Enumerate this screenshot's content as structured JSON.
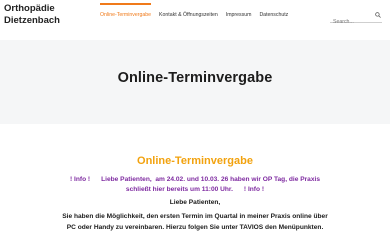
{
  "header": {
    "logo_line1": "Orthopädie",
    "logo_line2": "Dietzenbach"
  },
  "nav": {
    "items": [
      {
        "label": "Online-Terminvergabe",
        "active": true
      },
      {
        "label": "Kontakt & Öffnungszeiten",
        "active": false
      },
      {
        "label": "Impressum",
        "active": false
      },
      {
        "label": "Datenschutz",
        "active": false
      }
    ]
  },
  "search": {
    "placeholder": "Search...",
    "icon": "search-icon"
  },
  "hero": {
    "title": "Online-Terminvergabe"
  },
  "content": {
    "subtitle": "Online-Terminvergabe",
    "notice_line1": "! Info !      Liebe Patienten,  am 24.02. und 10.03. 26 haben wir OP Tag, die Praxis",
    "notice_line2": "schließt hier bereits um 11:00 Uhr.      ! Info !",
    "greeting": "Liebe Patienten,",
    "body_line1": "Sie haben die Möglichkeit, den ersten Termin im Quartal in meiner Praxis online über",
    "body_line2": "PC oder Handy zu vereinbaren. Hierzu folgen Sie unter TAVIOS den Menüpunkten."
  },
  "colors": {
    "accent": "#f07a1a",
    "subtitle": "#f2a20e",
    "notice": "#7e2aa0",
    "hero_bg": "#f5f6f7"
  }
}
